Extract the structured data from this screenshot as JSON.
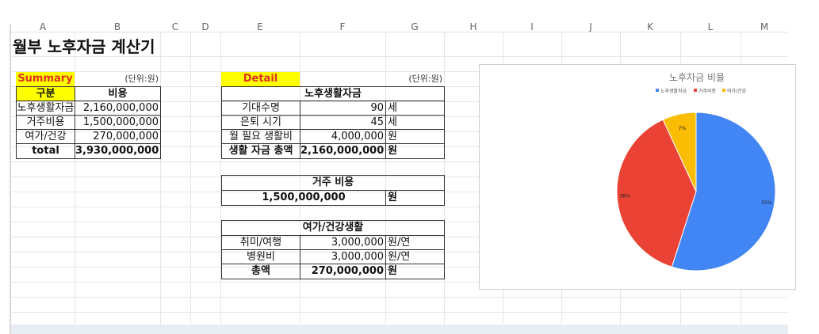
{
  "columns": [
    "A",
    "B",
    "C",
    "D",
    "E",
    "F",
    "G",
    "H",
    "I",
    "J",
    "K",
    "L",
    "M"
  ],
  "title": "월부 노후자금 계산기",
  "summary": {
    "header": "Summary",
    "unit": "(단위:원)",
    "col1": "구분",
    "col2": "비용",
    "rows": [
      {
        "label": "노후생활자금",
        "value": "2,160,000,000"
      },
      {
        "label": "거주비용",
        "value": "1,500,000,000"
      },
      {
        "label": "여가/건강",
        "value": "270,000,000"
      }
    ],
    "total_label": "total",
    "total_value": "3,930,000,000"
  },
  "detail": {
    "header": "Detail",
    "unit": "(단위:원)",
    "living": {
      "title": "노후생활자금",
      "rows": [
        {
          "label": "기대수명",
          "value": "90",
          "unit": "세"
        },
        {
          "label": "은퇴 시기",
          "value": "45",
          "unit": "세"
        },
        {
          "label": "월 필요 생활비",
          "value": "4,000,000",
          "unit": "원"
        }
      ],
      "total_label": "생활 자금 총액",
      "total_value": "2,160,000,000",
      "total_unit": "원"
    },
    "housing": {
      "title": "거주 비용",
      "value": "1,500,000,000",
      "unit": "원"
    },
    "leisure": {
      "title": "여가/건강생활",
      "rows": [
        {
          "label": "취미/여행",
          "value": "3,000,000",
          "unit": "원/연"
        },
        {
          "label": "병원비",
          "value": "3,000,000",
          "unit": "원/연"
        }
      ],
      "total_label": "총액",
      "total_value": "270,000,000",
      "total_unit": "원"
    }
  },
  "chart_data": {
    "type": "pie",
    "title": "노후자금 비율",
    "categories": [
      "노후생활자금",
      "거주비용",
      "여가/건강"
    ],
    "values": [
      2160000000,
      1500000000,
      270000000
    ],
    "labels": [
      "55%",
      "38%",
      "7%"
    ],
    "colors": [
      "#4285f4",
      "#ea4335",
      "#fbbc04"
    ],
    "legend_position": "top"
  }
}
